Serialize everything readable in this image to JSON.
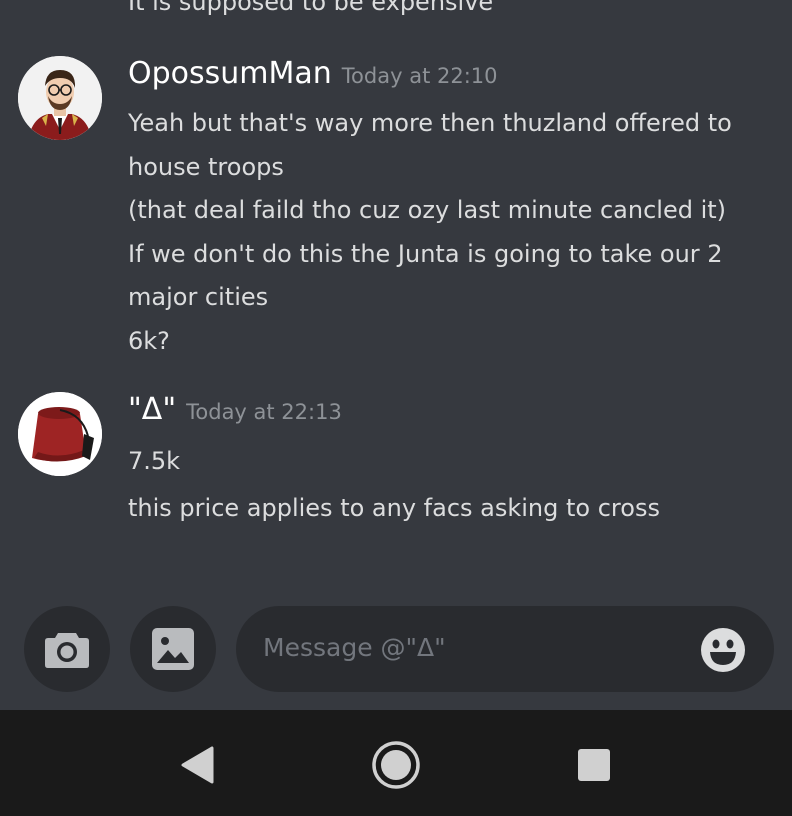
{
  "previous_message": {
    "text": "It is supposed to be expensive"
  },
  "messages": [
    {
      "username": "OpossumMan",
      "timestamp": "Today at 22:10",
      "avatar_icon": "cartoon-man-avatar",
      "lines": [
        "Yeah but that's way more then thuzland offered to",
        "house troops",
        "(that deal faild tho cuz ozy last minute cancled it)",
        "If we don't do this the Junta is going to take our 2",
        "major cities",
        "6k?"
      ]
    },
    {
      "username": "\"Δ\"",
      "timestamp": "Today at 22:13",
      "avatar_icon": "fez-hat-avatar",
      "lines": [
        "7.5k",
        "this price applies to any facs asking to cross"
      ]
    }
  ],
  "composer": {
    "camera_icon": "camera-icon",
    "gallery_icon": "image-icon",
    "placeholder": "Message @\"Δ\"",
    "emoji_icon": "smiley-face-icon"
  },
  "navbar": {
    "back_icon": "triangle-back-icon",
    "home_icon": "circle-home-icon",
    "recents_icon": "square-recents-icon"
  },
  "colors": {
    "background": "#36393f",
    "input_background": "#292b2f",
    "navbar_background": "#1a1a1a",
    "username": "#ffffff",
    "text": "#dcddde",
    "muted": "#8e9297"
  }
}
